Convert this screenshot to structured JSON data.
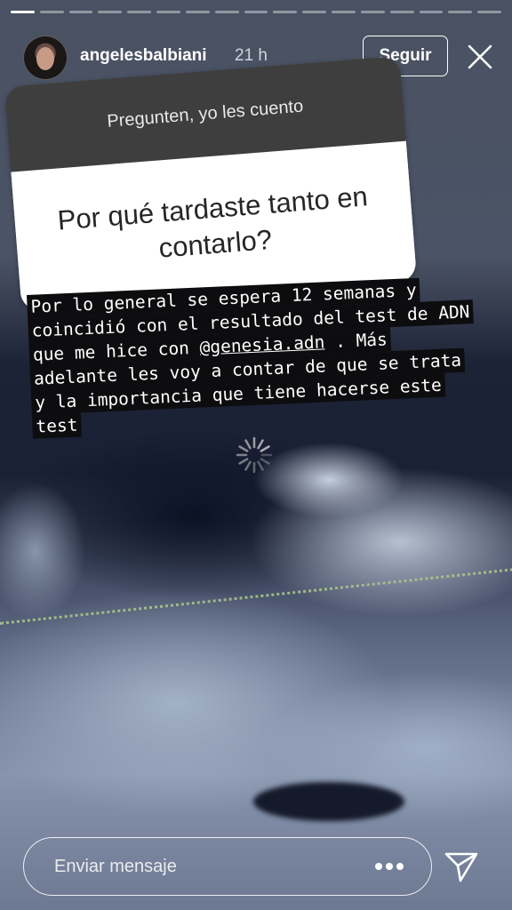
{
  "progress": {
    "segments": 17,
    "completed": 1
  },
  "header": {
    "username": "angelesbalbiani",
    "time": "21 h",
    "follow_label": "Seguir"
  },
  "sticker": {
    "prompt": "Pregunten, yo les cuento",
    "question": "Por qué tardaste tanto en contarlo?"
  },
  "caption": {
    "lines": [
      "Por lo general se espera 12 semanas y",
      "coincidió con el resultado del test de ADN",
      "que me hice con ",
      " . Más",
      "adelante les voy a contar de que se trata",
      "y la importancia que tiene hacerse este",
      "test"
    ],
    "mention": "@genesia.adn"
  },
  "footer": {
    "message_placeholder": "Enviar mensaje"
  },
  "icons": {
    "close": "close-icon",
    "more": "more-icon",
    "send": "send-icon",
    "loading": "loading-spinner-icon"
  },
  "colors": {
    "sticker_header": "#3f3e3e",
    "caption_bg": "#0d0d0f"
  }
}
